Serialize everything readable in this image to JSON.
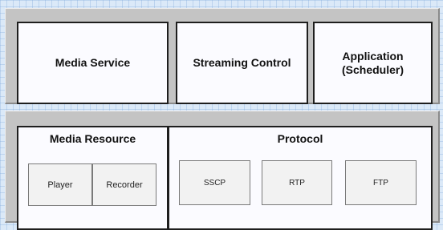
{
  "top_layer": {
    "media_service": "Media Service",
    "streaming_control": "Streaming Control",
    "application": "Application\n(Scheduler)"
  },
  "bottom_layer": {
    "media_resource": {
      "title": "Media Resource",
      "player": "Player",
      "recorder": "Recorder"
    },
    "protocol": {
      "title": "Protocol",
      "sscp": "SSCP",
      "rtp": "RTP",
      "ftp": "FTP"
    }
  },
  "colors": {
    "background": "#dbe9f8",
    "panel": "#c4c4c4",
    "box_fill": "#fbfbff",
    "box_border": "#1e1e1e",
    "component_border": "#7a7a7a"
  }
}
